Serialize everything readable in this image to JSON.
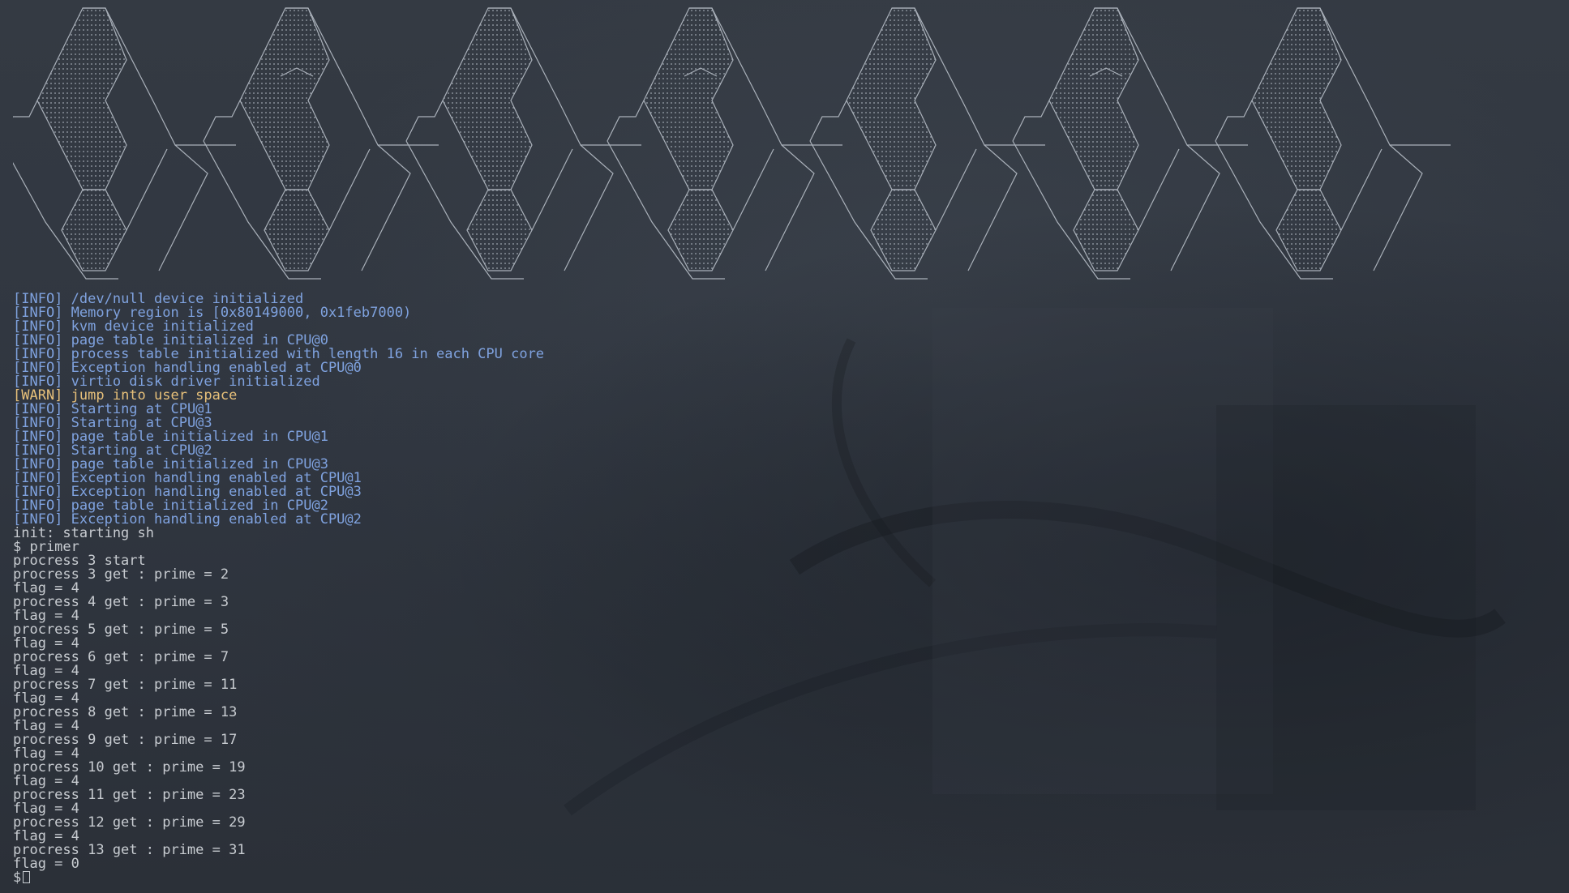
{
  "colors": {
    "background": "#2f353e",
    "info": "#7fa2df",
    "warn": "#e7c07a",
    "output": "#c8ccd1"
  },
  "banner_icon": "ascii-art-logo",
  "boot_log": [
    {
      "level": "[INFO]",
      "message": "/dev/null device initialized"
    },
    {
      "level": "[INFO]",
      "message": "Memory region is [0x80149000, 0x1feb7000)"
    },
    {
      "level": "[INFO]",
      "message": "kvm device initialized"
    },
    {
      "level": "[INFO]",
      "message": "page table initialized in CPU@0"
    },
    {
      "level": "[INFO]",
      "message": "process table initialized with length 16 in each CPU core"
    },
    {
      "level": "[INFO]",
      "message": "Exception handling enabled at CPU@0"
    },
    {
      "level": "[INFO]",
      "message": "virtio disk driver initialized"
    },
    {
      "level": "[WARN]",
      "message": "jump into user space"
    },
    {
      "level": "[INFO]",
      "message": "Starting at CPU@1"
    },
    {
      "level": "[INFO]",
      "message": "Starting at CPU@3"
    },
    {
      "level": "[INFO]",
      "message": "page table initialized in CPU@1"
    },
    {
      "level": "[INFO]",
      "message": "Starting at CPU@2"
    },
    {
      "level": "[INFO]",
      "message": "page table initialized in CPU@3"
    },
    {
      "level": "[INFO]",
      "message": "Exception handling enabled at CPU@1"
    },
    {
      "level": "[INFO]",
      "message": "Exception handling enabled at CPU@3"
    },
    {
      "level": "[INFO]",
      "message": "page table initialized in CPU@2"
    },
    {
      "level": "[INFO]",
      "message": "Exception handling enabled at CPU@2"
    }
  ],
  "output": [
    "init: starting sh",
    "$ primer",
    "procress 3 start",
    "procress 3 get : prime = 2",
    "flag = 4",
    "procress 4 get : prime = 3",
    "flag = 4",
    "procress 5 get : prime = 5",
    "flag = 4",
    "procress 6 get : prime = 7",
    "flag = 4",
    "procress 7 get : prime = 11",
    "flag = 4",
    "procress 8 get : prime = 13",
    "flag = 4",
    "procress 9 get : prime = 17",
    "flag = 4",
    "procress 10 get : prime = 19",
    "flag = 4",
    "procress 11 get : prime = 23",
    "flag = 4",
    "procress 12 get : prime = 29",
    "flag = 4",
    "procress 13 get : prime = 31",
    "flag = 0"
  ],
  "prompt": "$ "
}
